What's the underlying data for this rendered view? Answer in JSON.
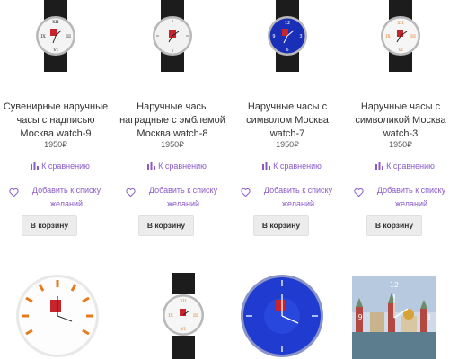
{
  "products": [
    {
      "title_line1": "Сувенирные наручные",
      "title_line2": "часы с надписью",
      "title_line3": "Москва watch-9",
      "price": "1950₽",
      "compare_label": "К сравнению",
      "wish_line1": "Добавить к списку",
      "wish_line2": "желаний",
      "cart_label": "В корзину",
      "dial": "white-roman"
    },
    {
      "title_line1": "Наручные часы",
      "title_line2": "наградные с эмблемой",
      "title_line3": "Москва watch-8",
      "price": "1950₽",
      "compare_label": "К сравнению",
      "wish_line1": "Добавить к списку",
      "wish_line2": "желаний",
      "cart_label": "В корзину",
      "dial": "white-emblem"
    },
    {
      "title_line1": "Наручные часы с",
      "title_line2": "символом Москва",
      "title_line3": "watch-7",
      "price": "1950₽",
      "compare_label": "К сравнению",
      "wish_line1": "Добавить к списку",
      "wish_line2": "желаний",
      "cart_label": "В корзину",
      "dial": "blue"
    },
    {
      "title_line1": "Наручные часы с",
      "title_line2": "символикой Москва",
      "title_line3": "watch-3",
      "price": "1950₽",
      "compare_label": "К сравнению",
      "wish_line1": "Добавить к списку",
      "wish_line2": "желаний",
      "cart_label": "В корзину",
      "dial": "white-orange"
    }
  ],
  "colors": {
    "accent": "#8a5bc8",
    "button_bg": "#ececec",
    "text": "#333333"
  }
}
